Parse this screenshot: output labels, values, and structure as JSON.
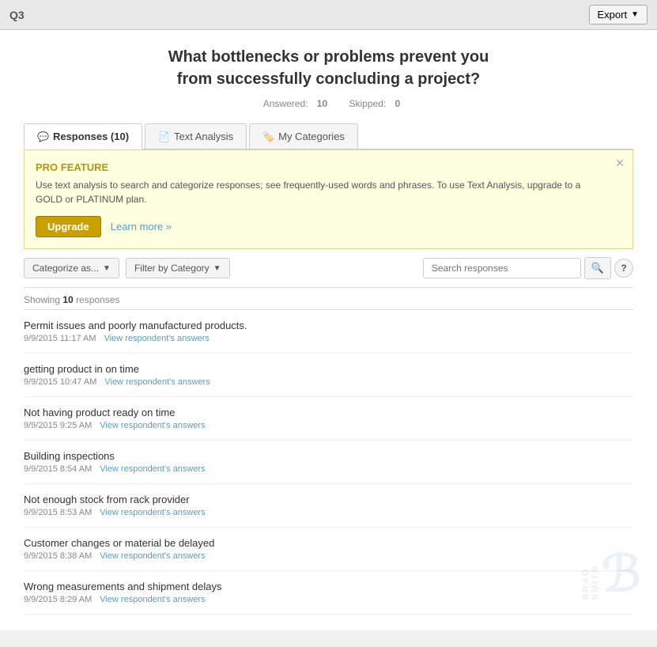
{
  "topbar": {
    "question_id": "Q3",
    "export_label": "Export"
  },
  "header": {
    "title": "What bottlenecks or problems prevent you from successfully concluding a project?",
    "answered_label": "Answered:",
    "answered_count": "10",
    "skipped_label": "Skipped:",
    "skipped_count": "0"
  },
  "tabs": [
    {
      "id": "responses",
      "label": "Responses",
      "count": "(10)",
      "icon": "💬",
      "active": true
    },
    {
      "id": "text-analysis",
      "label": "Text Analysis",
      "icon": "📄",
      "active": false
    },
    {
      "id": "my-categories",
      "label": "My Categories",
      "icon": "🏷️",
      "active": false
    }
  ],
  "pro_banner": {
    "title": "PRO FEATURE",
    "text": "Use text analysis to search and categorize responses; see frequently-used words and phrases. To use Text Analysis, upgrade to a GOLD or PLATINUM plan.",
    "upgrade_label": "Upgrade",
    "learn_more_label": "Learn more »"
  },
  "toolbar": {
    "categorize_label": "Categorize as...",
    "filter_label": "Filter by Category",
    "search_placeholder": "Search responses"
  },
  "responses_summary": {
    "showing_label": "Showing",
    "count": "10",
    "responses_label": "responses"
  },
  "responses": [
    {
      "text": "Permit issues and poorly manufactured products.",
      "date": "9/9/2015 11:17 AM",
      "link_label": "View respondent's answers"
    },
    {
      "text": "getting product in on time",
      "date": "9/9/2015 10:47 AM",
      "link_label": "View respondent's answers"
    },
    {
      "text": "Not having product ready on time",
      "date": "9/9/2015 9:25 AM",
      "link_label": "View respondent's answers"
    },
    {
      "text": "Building inspections",
      "date": "9/9/2015 8:54 AM",
      "link_label": "View respondent's answers"
    },
    {
      "text": "Not enough stock from rack provider",
      "date": "9/9/2015 8:53 AM",
      "link_label": "View respondent's answers"
    },
    {
      "text": "Customer changes or material be delayed",
      "date": "9/9/2015 8:38 AM",
      "link_label": "View respondent's answers"
    },
    {
      "text": "Wrong measurements and shipment delays",
      "date": "9/9/2015 8:29 AM",
      "link_label": "View respondent's answers"
    }
  ]
}
